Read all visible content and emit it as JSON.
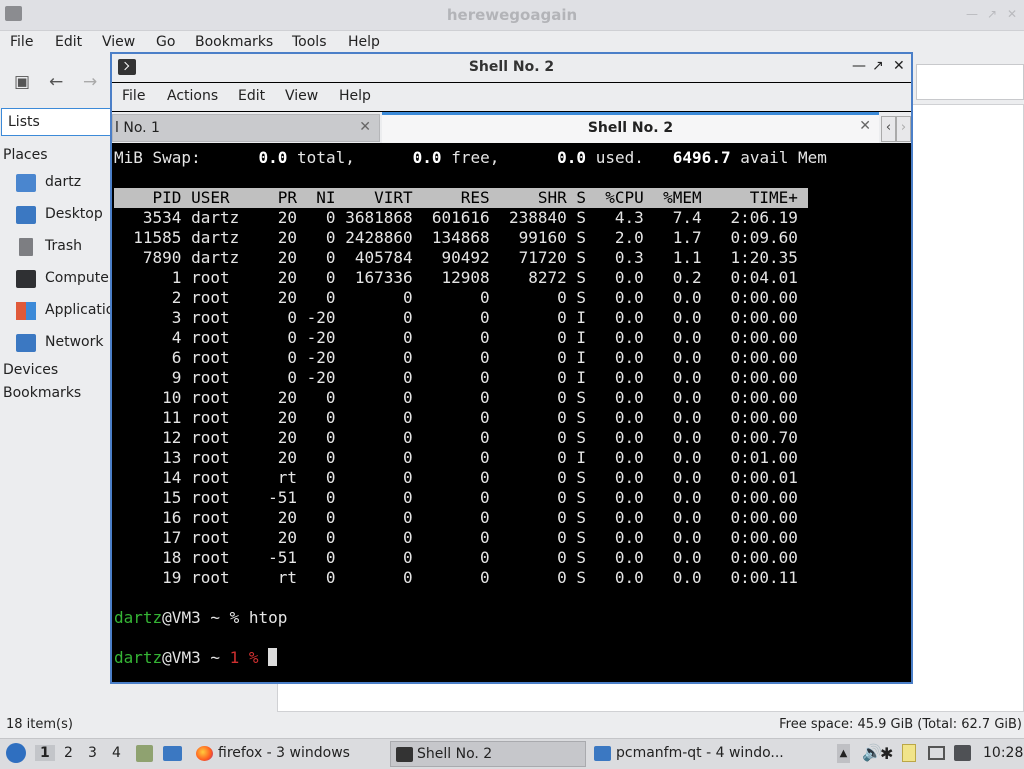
{
  "file_manager": {
    "title": "herewegoagain",
    "menu": [
      "File",
      "Edit",
      "View",
      "Go",
      "Bookmarks",
      "Tools",
      "Help"
    ],
    "side_combo": "Lists",
    "places_header": "Places",
    "places": [
      "dartz",
      "Desktop",
      "Trash",
      "Computer",
      "Applications",
      "Network"
    ],
    "devices_header": "Devices",
    "bookmarks_header": "Bookmarks",
    "status_left": "18 item(s)",
    "status_right": "Free space: 45.9 GiB (Total: 62.7 GiB)"
  },
  "terminal": {
    "title": "Shell No. 2",
    "menu": [
      "File",
      "Actions",
      "Edit",
      "View",
      "Help"
    ],
    "tabs": [
      {
        "label": "l No. 1"
      },
      {
        "label": "Shell No. 2"
      }
    ],
    "swap_line": {
      "prefix": "MiB Swap:",
      "total": "0.0",
      "total_lbl": "total,",
      "free": "0.0",
      "free_lbl": "free,",
      "used": "0.0",
      "used_lbl": "used.",
      "avail": "6496.7",
      "avail_lbl": "avail Mem"
    },
    "columns": [
      "PID",
      "USER",
      "PR",
      "NI",
      "VIRT",
      "RES",
      "SHR",
      "S",
      "%CPU",
      "%MEM",
      "TIME+"
    ],
    "rows": [
      [
        "3534",
        "dartz",
        "20",
        "0",
        "3681868",
        "601616",
        "238840",
        "S",
        "4.3",
        "7.4",
        "2:06.19"
      ],
      [
        "11585",
        "dartz",
        "20",
        "0",
        "2428860",
        "134868",
        "99160",
        "S",
        "2.0",
        "1.7",
        "0:09.60"
      ],
      [
        "7890",
        "dartz",
        "20",
        "0",
        "405784",
        "90492",
        "71720",
        "S",
        "0.3",
        "1.1",
        "1:20.35"
      ],
      [
        "1",
        "root",
        "20",
        "0",
        "167336",
        "12908",
        "8272",
        "S",
        "0.0",
        "0.2",
        "0:04.01"
      ],
      [
        "2",
        "root",
        "20",
        "0",
        "0",
        "0",
        "0",
        "S",
        "0.0",
        "0.0",
        "0:00.00"
      ],
      [
        "3",
        "root",
        "0",
        "-20",
        "0",
        "0",
        "0",
        "I",
        "0.0",
        "0.0",
        "0:00.00"
      ],
      [
        "4",
        "root",
        "0",
        "-20",
        "0",
        "0",
        "0",
        "I",
        "0.0",
        "0.0",
        "0:00.00"
      ],
      [
        "6",
        "root",
        "0",
        "-20",
        "0",
        "0",
        "0",
        "I",
        "0.0",
        "0.0",
        "0:00.00"
      ],
      [
        "9",
        "root",
        "0",
        "-20",
        "0",
        "0",
        "0",
        "I",
        "0.0",
        "0.0",
        "0:00.00"
      ],
      [
        "10",
        "root",
        "20",
        "0",
        "0",
        "0",
        "0",
        "S",
        "0.0",
        "0.0",
        "0:00.00"
      ],
      [
        "11",
        "root",
        "20",
        "0",
        "0",
        "0",
        "0",
        "S",
        "0.0",
        "0.0",
        "0:00.00"
      ],
      [
        "12",
        "root",
        "20",
        "0",
        "0",
        "0",
        "0",
        "S",
        "0.0",
        "0.0",
        "0:00.70"
      ],
      [
        "13",
        "root",
        "20",
        "0",
        "0",
        "0",
        "0",
        "I",
        "0.0",
        "0.0",
        "0:01.00"
      ],
      [
        "14",
        "root",
        "rt",
        "0",
        "0",
        "0",
        "0",
        "S",
        "0.0",
        "0.0",
        "0:00.01"
      ],
      [
        "15",
        "root",
        "-51",
        "0",
        "0",
        "0",
        "0",
        "S",
        "0.0",
        "0.0",
        "0:00.00"
      ],
      [
        "16",
        "root",
        "20",
        "0",
        "0",
        "0",
        "0",
        "S",
        "0.0",
        "0.0",
        "0:00.00"
      ],
      [
        "17",
        "root",
        "20",
        "0",
        "0",
        "0",
        "0",
        "S",
        "0.0",
        "0.0",
        "0:00.00"
      ],
      [
        "18",
        "root",
        "-51",
        "0",
        "0",
        "0",
        "0",
        "S",
        "0.0",
        "0.0",
        "0:00.00"
      ],
      [
        "19",
        "root",
        "rt",
        "0",
        "0",
        "0",
        "0",
        "S",
        "0.0",
        "0.0",
        "0:00.11"
      ]
    ],
    "prompt1": {
      "user": "dartz",
      "host": "@VM3 ~ %",
      "cmd": "htop"
    },
    "prompt2": {
      "user": "dartz",
      "host": "@VM3 ~",
      "code": "1 %"
    }
  },
  "taskbar": {
    "workspaces": [
      "1",
      "2",
      "3",
      "4"
    ],
    "tasks": [
      "firefox - 3 windows",
      "Shell No. 2",
      "pcmanfm-qt - 4 windo..."
    ],
    "clock": "10:28"
  },
  "colors": {
    "accent": "#3c8ad8",
    "prompt_user": "#35b535",
    "prompt_code": "#d03030"
  }
}
